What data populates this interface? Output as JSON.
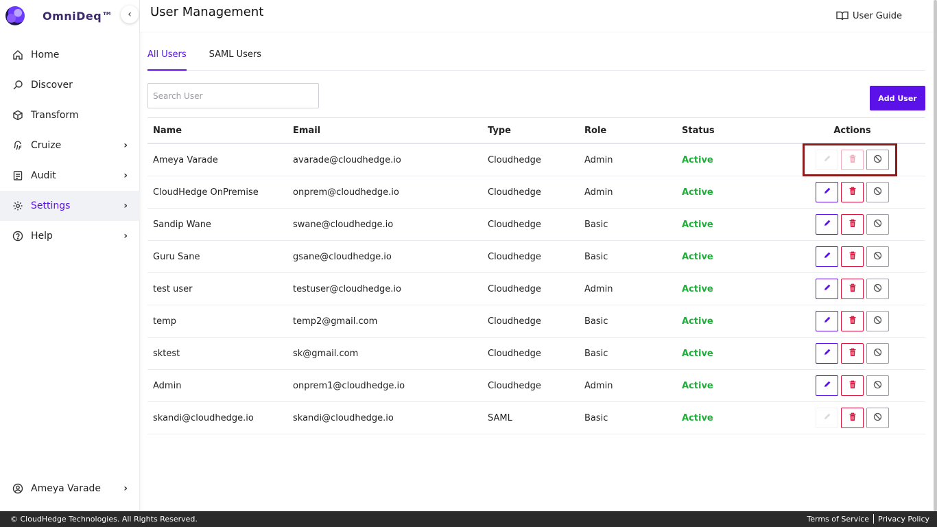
{
  "brand": {
    "name": "OmniDeq™"
  },
  "sidebar": {
    "items": [
      {
        "label": "Home",
        "icon": "home-icon",
        "chevron": false,
        "active": false
      },
      {
        "label": "Discover",
        "icon": "discover-icon",
        "chevron": false,
        "active": false
      },
      {
        "label": "Transform",
        "icon": "transform-icon",
        "chevron": false,
        "active": false
      },
      {
        "label": "Cruize",
        "icon": "fingerprint-icon",
        "chevron": true,
        "active": false
      },
      {
        "label": "Audit",
        "icon": "audit-icon",
        "chevron": true,
        "active": false
      },
      {
        "label": "Settings",
        "icon": "gear-icon",
        "chevron": true,
        "active": true
      },
      {
        "label": "Help",
        "icon": "help-icon",
        "chevron": true,
        "active": false
      }
    ],
    "user": {
      "label": "Ameya Varade"
    }
  },
  "header": {
    "title": "User Management",
    "guide_label": "User Guide"
  },
  "tabs": [
    {
      "label": "All Users",
      "active": true
    },
    {
      "label": "SAML Users",
      "active": false
    }
  ],
  "search": {
    "placeholder": "Search User",
    "value": ""
  },
  "add_button": {
    "label": "Add User"
  },
  "table": {
    "columns": [
      "Name",
      "Email",
      "Type",
      "Role",
      "Status",
      "Actions"
    ],
    "rows": [
      {
        "name": "Ameya Varade",
        "email": "avarade@cloudhedge.io",
        "type": "Cloudhedge",
        "role": "Admin",
        "status": "Active",
        "edit_enabled": false,
        "delete_enabled": false
      },
      {
        "name": "CloudHedge OnPremise",
        "email": "onprem@cloudhedge.io",
        "type": "Cloudhedge",
        "role": "Admin",
        "status": "Active",
        "edit_enabled": true,
        "delete_enabled": true
      },
      {
        "name": "Sandip Wane",
        "email": "swane@cloudhedge.io",
        "type": "Cloudhedge",
        "role": "Basic",
        "status": "Active",
        "edit_enabled": true,
        "delete_enabled": true
      },
      {
        "name": "Guru Sane",
        "email": "gsane@cloudhedge.io",
        "type": "Cloudhedge",
        "role": "Basic",
        "status": "Active",
        "edit_enabled": true,
        "delete_enabled": true
      },
      {
        "name": "test user",
        "email": "testuser@cloudhedge.io",
        "type": "Cloudhedge",
        "role": "Admin",
        "status": "Active",
        "edit_enabled": true,
        "delete_enabled": true
      },
      {
        "name": "temp",
        "email": "temp2@gmail.com",
        "type": "Cloudhedge",
        "role": "Basic",
        "status": "Active",
        "edit_enabled": true,
        "delete_enabled": true
      },
      {
        "name": "sktest",
        "email": "sk@gmail.com",
        "type": "Cloudhedge",
        "role": "Basic",
        "status": "Active",
        "edit_enabled": true,
        "delete_enabled": true
      },
      {
        "name": "Admin",
        "email": "onprem1@cloudhedge.io",
        "type": "Cloudhedge",
        "role": "Admin",
        "status": "Active",
        "edit_enabled": true,
        "delete_enabled": true
      },
      {
        "name": "skandi@cloudhedge.io",
        "email": "skandi@cloudhedge.io",
        "type": "SAML",
        "role": "Basic",
        "status": "Active",
        "edit_enabled": false,
        "delete_enabled": true
      }
    ]
  },
  "footer": {
    "copyright": "© CloudHedge Technologies. All Rights Reserved.",
    "terms": "Terms of Service",
    "privacy": "Privacy Policy"
  },
  "colors": {
    "accent": "#5b12e8",
    "danger": "#d6143c",
    "success": "#1fae3a",
    "highlight": "#8b1a1a"
  }
}
